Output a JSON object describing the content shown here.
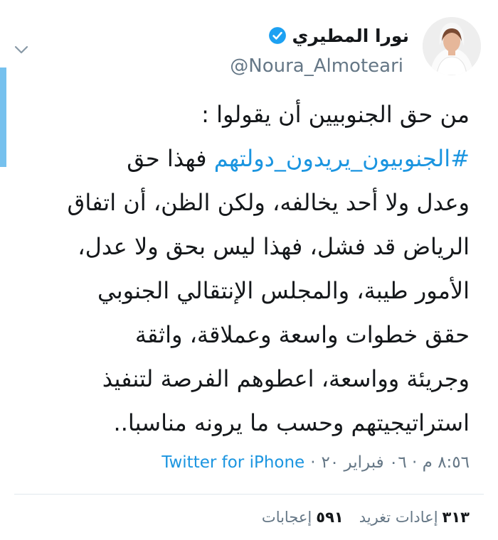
{
  "tweet": {
    "author": {
      "display_name": "نورا المطيري",
      "handle": "@Noura_Almoteari",
      "verified": true
    },
    "text_lines": [
      "من حق الجنوبيين أن يقولوا :",
      "فهذا حق",
      "وعدل ولا أحد يخالفه، ولكن الظن، أن اتفاق",
      "الرياض قد فشل، فهذا ليس بحق ولا عدل،",
      "الأمور طيبة، والمجلس الإنتقالي الجنوبي",
      "حقق خطوات واسعة وعملاقة، واثقة",
      "وجريئة وواسعة، اعطوهم الفرصة لتنفيذ",
      "استراتيجيتهم وحسب ما يرونه مناسبا.."
    ],
    "hashtag": "#الجنوبيون_يريدون_دولتهم",
    "timestamp": "٨:٥٦ م · ٠٦ فبراير ٢٠",
    "separator": "·",
    "source": "Twitter for iPhone",
    "stats": {
      "retweets_count": "٣١٣",
      "retweets_label": "إعادات تغريد",
      "likes_count": "٥٩١",
      "likes_label": "إعجابات"
    }
  },
  "colors": {
    "link": "#1b95e0",
    "secondary_text": "#657786",
    "verified_badge": "#1da1f2",
    "edge_bar": "#76c1ee"
  }
}
